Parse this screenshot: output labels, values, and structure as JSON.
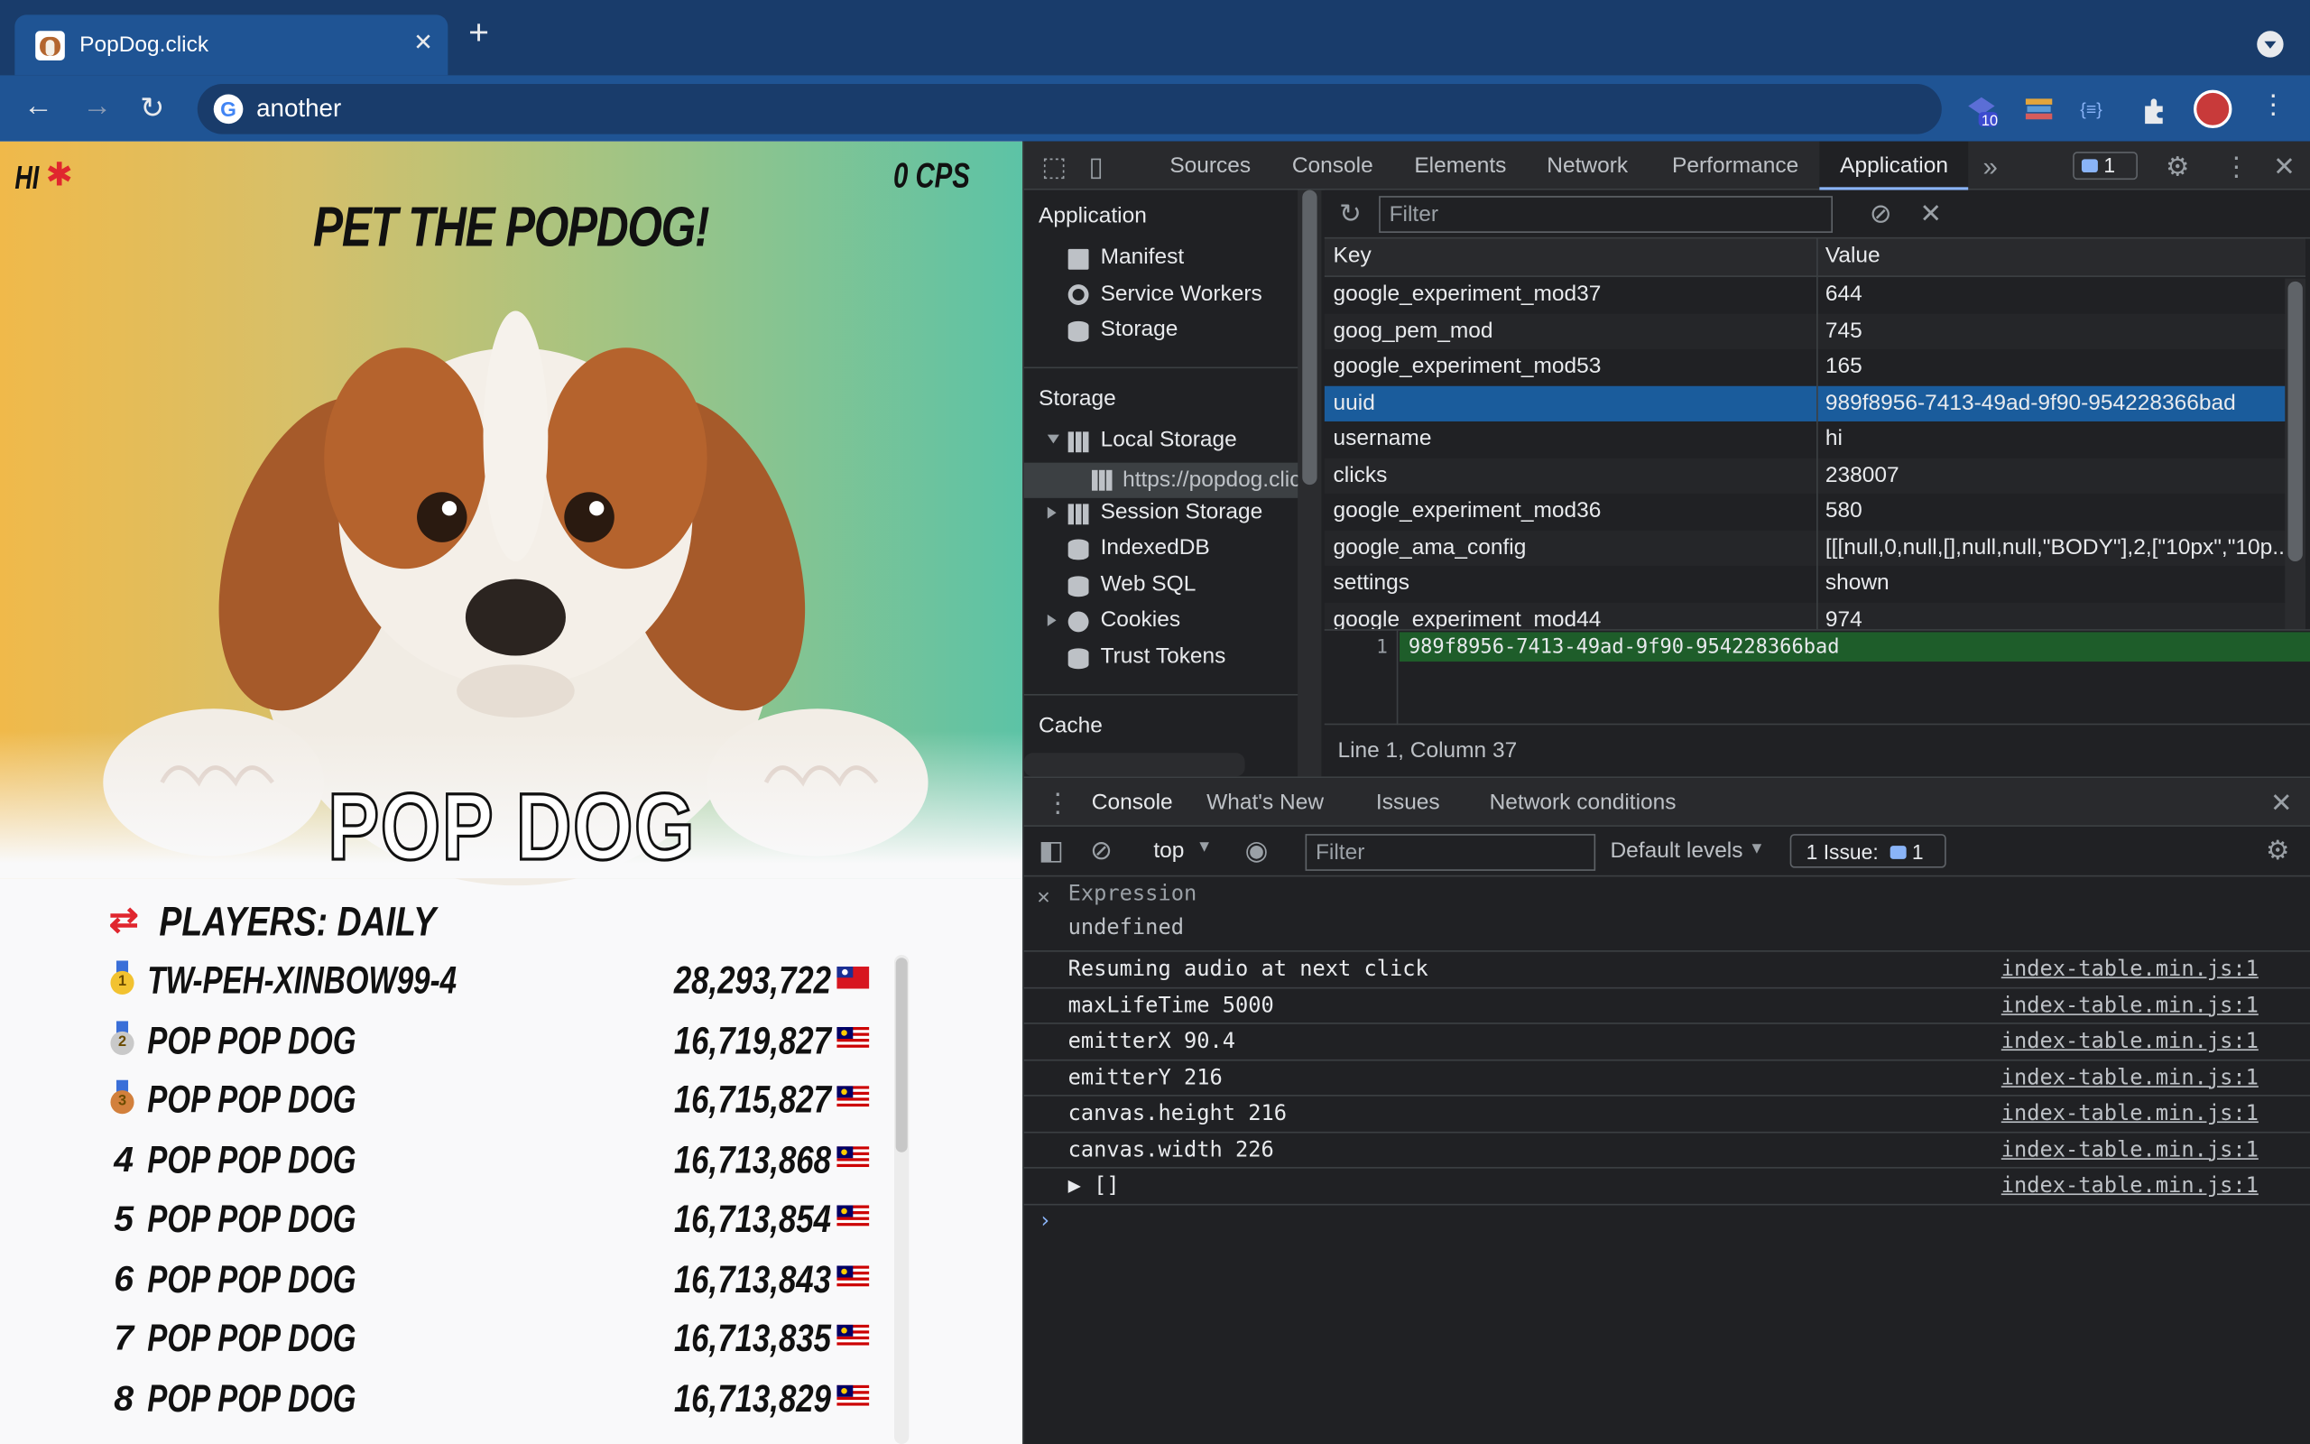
{
  "browser": {
    "tab_title": "PopDog.click",
    "tab_close": "✕",
    "new_tab": "+",
    "omnibox_text": "another",
    "ext_badge": "10",
    "ext_json": "{≡}"
  },
  "page": {
    "hi_label": "HI",
    "cps_label": "0 CPS",
    "title": "PET THE POPDOG!",
    "logo": "POP DOG",
    "leaderboard_title": "PLAYERS: DAILY",
    "players": [
      {
        "rank": "1",
        "medal": "gold",
        "name": "TW-PEH-XINBOW99-4",
        "score": "28,293,722",
        "flag": "taiwan"
      },
      {
        "rank": "2",
        "medal": "silver",
        "name": "POP POP DOG",
        "score": "16,719,827",
        "flag": "malaysia"
      },
      {
        "rank": "3",
        "medal": "bronze",
        "name": "POP POP DOG",
        "score": "16,715,827",
        "flag": "malaysia"
      },
      {
        "rank": "4",
        "medal": "",
        "name": "POP POP DOG",
        "score": "16,713,868",
        "flag": "malaysia"
      },
      {
        "rank": "5",
        "medal": "",
        "name": "POP POP DOG",
        "score": "16,713,854",
        "flag": "malaysia"
      },
      {
        "rank": "6",
        "medal": "",
        "name": "POP POP DOG",
        "score": "16,713,843",
        "flag": "malaysia"
      },
      {
        "rank": "7",
        "medal": "",
        "name": "POP POP DOG",
        "score": "16,713,835",
        "flag": "malaysia"
      },
      {
        "rank": "8",
        "medal": "",
        "name": "POP POP DOG",
        "score": "16,713,829",
        "flag": "malaysia"
      }
    ]
  },
  "devtools": {
    "tabs": [
      "Sources",
      "Console",
      "Elements",
      "Network",
      "Performance",
      "Application"
    ],
    "active_tab": "Application",
    "issues_count": "1",
    "sidebar": {
      "application_header": "Application",
      "application_items": [
        "Manifest",
        "Service Workers",
        "Storage"
      ],
      "storage_header": "Storage",
      "local_storage": "Local Storage",
      "local_storage_origin": "https://popdog.click",
      "storage_items": [
        "Session Storage",
        "IndexedDB",
        "Web SQL",
        "Cookies",
        "Trust Tokens"
      ],
      "cache_header": "Cache"
    },
    "storage_filter_placeholder": "Filter",
    "columns": {
      "key": "Key",
      "value": "Value"
    },
    "rows": [
      {
        "key": "google_experiment_mod37",
        "value": "644"
      },
      {
        "key": "goog_pem_mod",
        "value": "745"
      },
      {
        "key": "google_experiment_mod53",
        "value": "165"
      },
      {
        "key": "uuid",
        "value": "989f8956-7413-49ad-9f90-954228366bad",
        "selected": true
      },
      {
        "key": "username",
        "value": "hi"
      },
      {
        "key": "clicks",
        "value": "238007"
      },
      {
        "key": "google_experiment_mod36",
        "value": "580"
      },
      {
        "key": "google_ama_config",
        "value": "[[[null,0,null,[],null,null,\"BODY\"],2,[\"10px\",\"10p..."
      },
      {
        "key": "settings",
        "value": "shown"
      },
      {
        "key": "google_experiment_mod44",
        "value": "974"
      }
    ],
    "preview_line_no": "1",
    "preview_value": "989f8956-7413-49ad-9f90-954228366bad",
    "status": "Line 1, Column 37",
    "drawer_tabs": [
      "Console",
      "What's New",
      "Issues",
      "Network conditions"
    ],
    "context": "top",
    "console_filter_placeholder": "Filter",
    "levels": "Default levels",
    "issues_label": "1 Issue:",
    "issues_label_count": "1",
    "expression_label": "Expression",
    "expression_value": "undefined",
    "logs": [
      {
        "msg": "Resuming audio at next click",
        "src": "index-table.min.js:1"
      },
      {
        "msg": "maxLifeTime 5000",
        "src": "index-table.min.js:1"
      },
      {
        "msg": "emitterX 90.4",
        "src": "index-table.min.js:1"
      },
      {
        "msg": "emitterY 216",
        "src": "index-table.min.js:1"
      },
      {
        "msg": "canvas.height 216",
        "src": "index-table.min.js:1"
      },
      {
        "msg": "canvas.width 226",
        "src": "index-table.min.js:1"
      },
      {
        "msg": "▶ []",
        "src": "index-table.min.js:1"
      }
    ],
    "prompt": "›"
  }
}
